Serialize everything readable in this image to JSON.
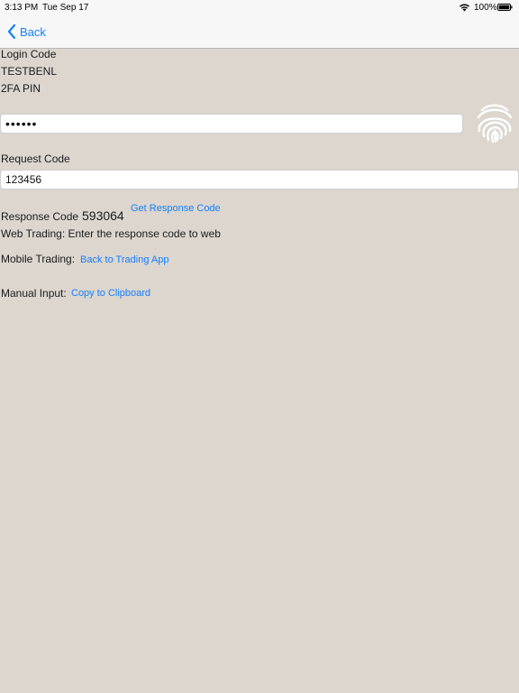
{
  "status_bar": {
    "time": "3:13 PM",
    "date": "Tue Sep 17",
    "battery_percent": "100%",
    "icons": [
      "wifi-icon",
      "battery-icon"
    ]
  },
  "nav": {
    "back_label": "Back",
    "back_icon": "chevron-left-icon"
  },
  "form": {
    "login_code_label": "Login Code",
    "login_code_value": "TESTBENL",
    "pin_label": "2FA PIN",
    "pin_value": "••••••",
    "fingerprint_icon": "fingerprint-icon",
    "request_code_label": "Request Code",
    "request_code_value": "123456",
    "response_code_label": "Response Code",
    "response_code_value": "593064",
    "get_response_link": "Get Response Code",
    "web_trading_text": "Web Trading: Enter the response code to web",
    "mobile_trading_label": "Mobile Trading:",
    "back_to_app_link": "Back to Trading App",
    "manual_input_label": "Manual Input:",
    "copy_link": "Copy to Clipboard"
  },
  "colors": {
    "background": "#dcd6cf",
    "accent": "#157efb",
    "bar": "#f7f7f7"
  }
}
